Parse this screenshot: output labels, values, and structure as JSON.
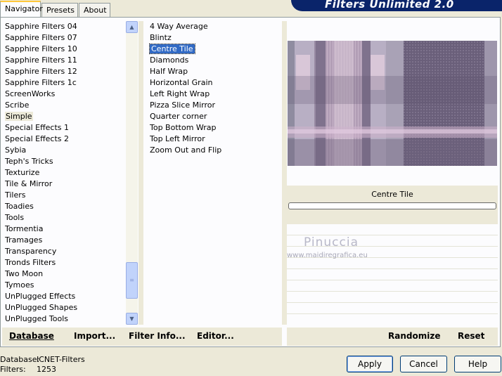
{
  "tabs": [
    {
      "label": "Navigator",
      "active": true
    },
    {
      "label": "Presets",
      "active": false
    },
    {
      "label": "About",
      "active": false
    }
  ],
  "banner": {
    "title": "Filters Unlimited 2.0"
  },
  "categories": [
    "Sapphire Filters 04",
    "Sapphire Filters 07",
    "Sapphire Filters 10",
    "Sapphire Filters 11",
    "Sapphire Filters 12",
    "Sapphire Filters 1c",
    "ScreenWorks",
    "Scribe",
    "Simple",
    "Special Effects 1",
    "Special Effects 2",
    "Sybia",
    "Teph's Tricks",
    "Texturize",
    "Tile & Mirror",
    "Tilers",
    "Toadies",
    "Tools",
    "Tormentia",
    "Tramages",
    "Transparency",
    "Tronds Filters",
    "Two Moon",
    "Tymoes",
    "UnPlugged Effects",
    "UnPlugged Shapes",
    "UnPlugged Tools"
  ],
  "selected_category": "Simple",
  "filters": [
    "4 Way Average",
    "Blintz",
    "Centre Tile",
    "Diamonds",
    "Half Wrap",
    "Horizontal Grain",
    "Left Right Wrap",
    "Pizza Slice Mirror",
    "Quarter corner",
    "Top Bottom Wrap",
    "Top Left Mirror",
    "Zoom Out and Flip"
  ],
  "selected_filter": "Centre Tile",
  "preview": {
    "filter_name": "Centre Tile",
    "progress": 0
  },
  "watermark": {
    "name": "Pinuccia",
    "url": "www.maidiregrafica.eu"
  },
  "toolbar": {
    "database": "Database",
    "import": "Import...",
    "filter_info": "Filter Info...",
    "editor": "Editor...",
    "randomize": "Randomize",
    "reset": "Reset"
  },
  "status": {
    "database_label": "Database:",
    "database_value": "ICNET-Filters",
    "filters_label": "Filters:",
    "filters_value": "1253"
  },
  "buttons": {
    "apply": "Apply",
    "cancel": "Cancel",
    "help": "Help"
  },
  "colors": {
    "selection": "#316AC5",
    "banner": "#0A246A",
    "panel_bg": "#ECE9D8"
  },
  "icons": {
    "scroll_up": "chevron-up-icon",
    "scroll_down": "chevron-down-icon",
    "thumb_grip": "grip-icon"
  }
}
